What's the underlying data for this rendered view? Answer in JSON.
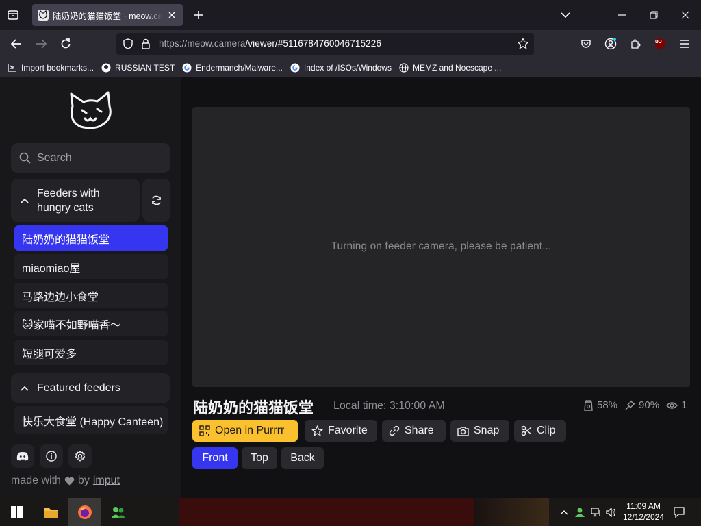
{
  "browser": {
    "tab_title": "陆奶奶的猫猫饭堂 · meow.camera",
    "url_host": "https://meow.camera",
    "url_path": "/viewer/#5116784760046715226",
    "bookmarks": [
      {
        "label": "Import bookmarks...",
        "icon": "import-icon"
      },
      {
        "label": "RUSSIAN TEST",
        "icon": "github-icon"
      },
      {
        "label": "Endermanch/Malware...",
        "icon": "google-icon"
      },
      {
        "label": "Index of /ISOs/Windows",
        "icon": "google-icon"
      },
      {
        "label": "MEMZ and Noescape ...",
        "icon": "globe-icon"
      }
    ],
    "extension_badge": "uO"
  },
  "sidebar": {
    "search_placeholder": "Search",
    "hungry_group_label": "Feeders with hungry cats",
    "hungry_feeders": [
      "陆奶奶的猫猫饭堂",
      "miaomiao屋",
      "马路边边小食堂",
      "🐱家喵不如野喵香～",
      "短腿可爱多"
    ],
    "featured_group_label": "Featured feeders",
    "featured_feeders": [
      "快乐大食堂 (Happy Canteen)"
    ],
    "made_with": "made with",
    "by": "by",
    "author": "imput"
  },
  "viewer": {
    "status_message": "Turning on feeder camera, please be patient..."
  },
  "feeder": {
    "name": "陆奶奶的猫猫饭堂",
    "local_time": "Local time: 3:10:00 AM",
    "food_level": "58%",
    "battery_level": "90%",
    "viewers": "1"
  },
  "actions": {
    "open_in_purrrr": "Open in Purrrr",
    "favorite": "Favorite",
    "share": "Share",
    "snap": "Snap",
    "clip": "Clip"
  },
  "cameras": {
    "front": "Front",
    "top": "Top",
    "back": "Back",
    "selected": "Front"
  },
  "taskbar": {
    "time": "11:09 AM",
    "date": "12/12/2024"
  },
  "colors": {
    "accent_blue": "#3636f0",
    "accent_yellow": "#fbc02d"
  }
}
